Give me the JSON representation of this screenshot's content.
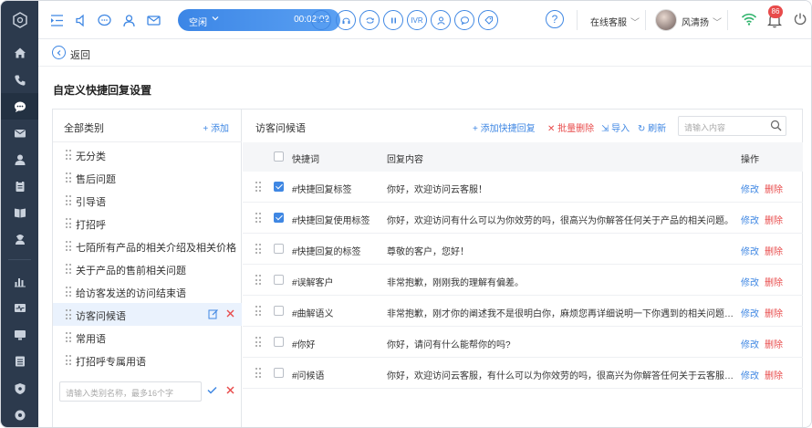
{
  "topbar": {
    "status": "空闲",
    "timer": "00:02:02",
    "call_buttons": [
      "IVR"
    ],
    "online_status": "在线客服",
    "user_name": "风清扬",
    "notification_count": "86"
  },
  "main": {
    "back_label": "返回",
    "page_title": "自定义快捷回复设置"
  },
  "categories": {
    "title": "全部类别",
    "add_label": "+ 添加",
    "items": [
      {
        "label": "无分类"
      },
      {
        "label": "售后问题"
      },
      {
        "label": "引导语"
      },
      {
        "label": "打招呼"
      },
      {
        "label": "七陌所有产品的相关介绍及相关价格"
      },
      {
        "label": "关于产品的售前相关问题"
      },
      {
        "label": "给访客发送的访问结束语"
      },
      {
        "label": "访客问候语"
      },
      {
        "label": "常用语"
      },
      {
        "label": "打招呼专属用语"
      }
    ],
    "active_index": 7,
    "input_placeholder": "请输入类别名称，最多16个字"
  },
  "replies": {
    "title": "访客问候语",
    "add_label": "+ 添加快捷回复",
    "batch_delete_label": "批量删除",
    "import_label": "导入",
    "refresh_label": "刷新",
    "search_placeholder": "请输入内容",
    "columns": {
      "keyword": "快捷词",
      "content": "回复内容",
      "ops": "操作"
    },
    "edit_label": "修改",
    "delete_label": "删除",
    "rows": [
      {
        "keyword": "#快捷回复标签",
        "content": "你好，欢迎访问云客服！",
        "checked": true
      },
      {
        "keyword": "#快捷回复使用标签",
        "content": "你好，欢迎访问有什么可以为你效劳的吗，很高兴为你解答任何关于产品的相关问题。",
        "checked": true
      },
      {
        "keyword": "#快捷回复的标签",
        "content": "尊敬的客户，您好！",
        "checked": false
      },
      {
        "keyword": "#误解客户",
        "content": "非常抱歉，刚刚我的理解有偏差。",
        "checked": false
      },
      {
        "keyword": "#曲解语义",
        "content": "非常抱歉，刚才你的阐述我不是很明白你，麻烦您再详细说明一下你遇到的相关问题可以吗?",
        "checked": false
      },
      {
        "keyword": "#你好",
        "content": "你好，请问有什么能帮你的吗?",
        "checked": false
      },
      {
        "keyword": "#问候语",
        "content": "你好，欢迎访问云客服，有什么可以为你效劳的吗，很高兴为你解答任何关于云客服产品的...",
        "checked": false
      }
    ]
  },
  "colors": {
    "accent": "#3f87e3",
    "danger": "#e84b4b",
    "nav_bg": "#2c3a4d"
  },
  "icons": [
    "home-icon",
    "phone-icon",
    "chat-icon",
    "mail-icon",
    "user-icon",
    "clipboard-icon",
    "book-icon",
    "agent-icon",
    "stats-icon",
    "monitor-icon",
    "screen-icon",
    "list-icon",
    "shield-icon",
    "settings-icon"
  ]
}
